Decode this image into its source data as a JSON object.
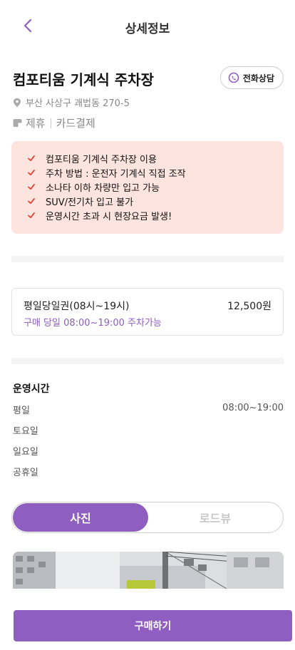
{
  "header": {
    "title": "상세정보",
    "back_icon": "chevron-left-icon"
  },
  "lot": {
    "name": "컴포티움 기계식 주차장",
    "call_label": "전화상담",
    "call_icon": "phone-chat-icon",
    "address": "부산 사상구 괘법동 270-5",
    "address_icon": "location-pin-icon",
    "tag_icon": "parking-tag-icon",
    "tags": [
      "제휴",
      "카드결제"
    ]
  },
  "notices": [
    "컴포티움 기계식 주차장 이용",
    "주차 방법 : 운전자 기계식 직접 조작",
    "소나타 이하 차량만 입고 가능",
    "SUV/전기차 입고 불가",
    "운영시간 초과 시 현장요금 발생!"
  ],
  "ticket": {
    "name": "평일당일권(08시~19시)",
    "price": "12,500원",
    "desc": "구매 당일 08:00~19:00 주차가능"
  },
  "hours": {
    "title": "운영시간",
    "rows": [
      {
        "day": "평일",
        "time": "08:00~19:00"
      },
      {
        "day": "토요일",
        "time": ""
      },
      {
        "day": "일요일",
        "time": ""
      },
      {
        "day": "공휴일",
        "time": ""
      }
    ]
  },
  "toggle": {
    "active": "사진",
    "inactive": "로드뷰"
  },
  "buy_label": "구매하기",
  "colors": {
    "accent": "#8e5ec0",
    "notice_bg": "#fde4df",
    "check": "#d9483b"
  }
}
